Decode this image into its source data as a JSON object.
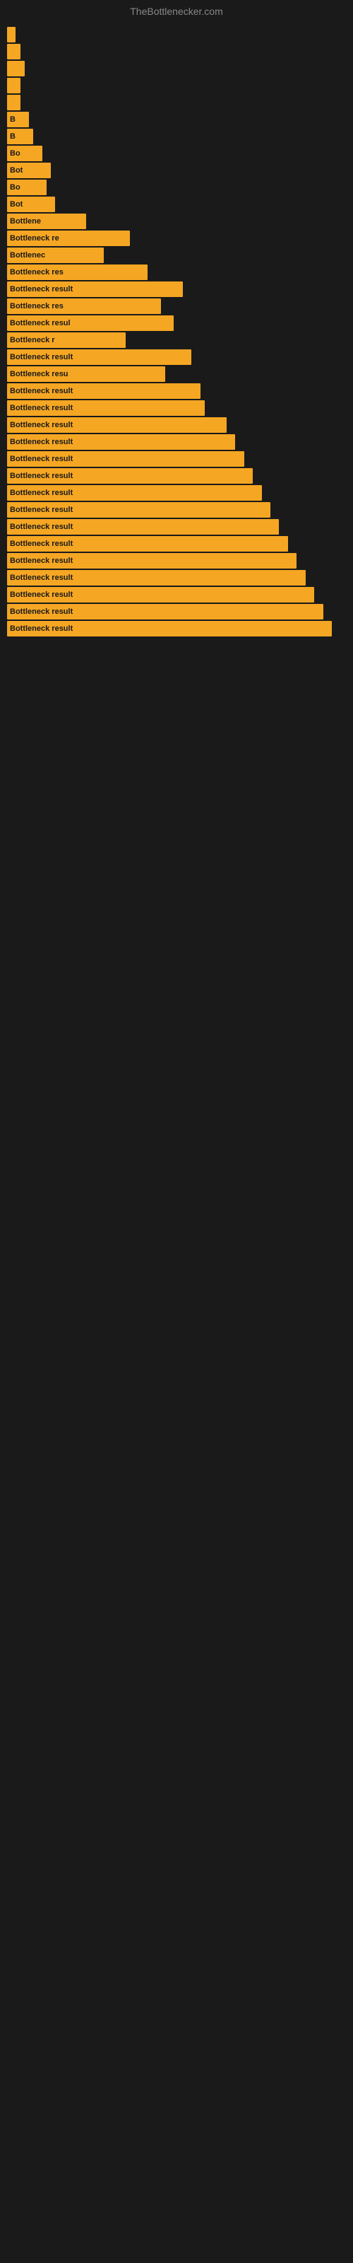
{
  "site": {
    "title": "TheBottlenecker.com"
  },
  "bars": [
    {
      "label": "",
      "width": 2
    },
    {
      "label": "",
      "width": 3
    },
    {
      "label": "",
      "width": 4
    },
    {
      "label": "",
      "width": 3
    },
    {
      "label": "",
      "width": 3
    },
    {
      "label": "B",
      "width": 5
    },
    {
      "label": "B",
      "width": 6
    },
    {
      "label": "Bo",
      "width": 8
    },
    {
      "label": "Bot",
      "width": 10
    },
    {
      "label": "Bo",
      "width": 9
    },
    {
      "label": "Bot",
      "width": 11
    },
    {
      "label": "Bottlene",
      "width": 18
    },
    {
      "label": "Bottleneck re",
      "width": 28
    },
    {
      "label": "Bottlenec",
      "width": 22
    },
    {
      "label": "Bottleneck res",
      "width": 32
    },
    {
      "label": "Bottleneck result",
      "width": 40
    },
    {
      "label": "Bottleneck res",
      "width": 35
    },
    {
      "label": "Bottleneck resul",
      "width": 38
    },
    {
      "label": "Bottleneck r",
      "width": 27
    },
    {
      "label": "Bottleneck result",
      "width": 42
    },
    {
      "label": "Bottleneck resu",
      "width": 36
    },
    {
      "label": "Bottleneck result",
      "width": 44
    },
    {
      "label": "Bottleneck result",
      "width": 45
    },
    {
      "label": "Bottleneck result",
      "width": 50
    },
    {
      "label": "Bottleneck result",
      "width": 52
    },
    {
      "label": "Bottleneck result",
      "width": 54
    },
    {
      "label": "Bottleneck result",
      "width": 56
    },
    {
      "label": "Bottleneck result",
      "width": 58
    },
    {
      "label": "Bottleneck result",
      "width": 60
    },
    {
      "label": "Bottleneck result",
      "width": 62
    },
    {
      "label": "Bottleneck result",
      "width": 64
    },
    {
      "label": "Bottleneck result",
      "width": 66
    },
    {
      "label": "Bottleneck result",
      "width": 68
    },
    {
      "label": "Bottleneck result",
      "width": 70
    },
    {
      "label": "Bottleneck result",
      "width": 72
    },
    {
      "label": "Bottleneck result",
      "width": 74
    }
  ]
}
